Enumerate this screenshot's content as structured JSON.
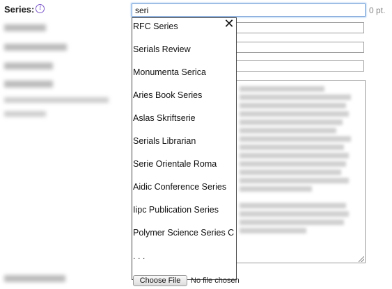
{
  "form": {
    "series_label": "Series:",
    "series_value": "seri",
    "points_text": "0 pt.",
    "file_button_label": "Choose File",
    "file_status": "No file chosen"
  },
  "autocomplete": {
    "close_glyph": "✕",
    "items": [
      "RFC Series",
      "Serials Review",
      "Monumenta Serica",
      "Aries Book Series",
      "Aslas Skriftserie",
      "Serials Librarian",
      "Serie Orientale Roma",
      "Aidic Conference Series",
      "Iipc Publication Series",
      "Polymer Science Series C",
      ". . ."
    ]
  },
  "colors": {
    "focus_border": "#7fa6d8",
    "info_icon": "#7b57c9"
  },
  "icons": {
    "info": "info-circle-icon",
    "close": "close-icon",
    "resize": "resize-handle-icon"
  }
}
